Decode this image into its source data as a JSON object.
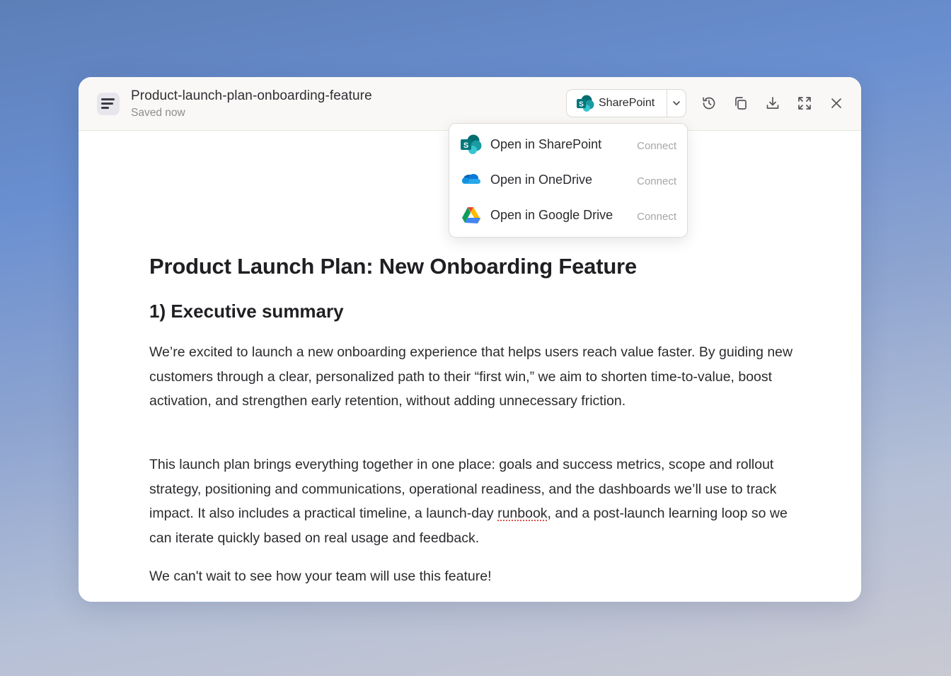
{
  "titlebar": {
    "doc_title": "Product-launch-plan-onboarding-feature",
    "status": "Saved now",
    "doc_icon": "document-lines-icon"
  },
  "toolbar": {
    "open_in_label": "SharePoint",
    "open_in_icon": "sharepoint-icon",
    "caret_icon": "chevron-down-icon",
    "actions": [
      {
        "name": "history",
        "icon": "history-icon"
      },
      {
        "name": "copy",
        "icon": "copy-icon"
      },
      {
        "name": "download",
        "icon": "download-icon"
      },
      {
        "name": "expand",
        "icon": "expand-icon"
      },
      {
        "name": "close",
        "icon": "close-icon"
      }
    ]
  },
  "open_menu": {
    "items": [
      {
        "label": "Open in SharePoint",
        "action": "Connect",
        "icon": "sharepoint-icon"
      },
      {
        "label": "Open in OneDrive",
        "action": "Connect",
        "icon": "onedrive-icon"
      },
      {
        "label": "Open in Google Drive",
        "action": "Connect",
        "icon": "google-drive-icon"
      }
    ]
  },
  "document": {
    "heading": "Product Launch Plan: New Onboarding Feature",
    "section_1": "1) Executive summary",
    "p1": "We’re excited to launch a new onboarding experience that helps users reach value faster. By guiding new customers through a clear, personalized path to their “first win,” we aim to shorten time-to-value, boost activation, and strengthen early retention, without adding unnecessary friction.",
    "p2_before": "This launch plan brings everything together in one place: goals and success metrics, scope and rollout strategy, positioning and communications, operational readiness, and the dashboards we’ll use to track impact. It also includes a practical timeline, a launch-day ",
    "p2_flagged": "runbook",
    "p2_after": ", and a post-launch learning loop so we can iterate quickly based on real usage and feedback.",
    "p3": "We can't wait to see how your team will use this feature!"
  },
  "colors": {
    "sharepoint_teal": "#038387",
    "onedrive_blue": "#0f78d4",
    "spellcheck_red": "#d9534f"
  }
}
